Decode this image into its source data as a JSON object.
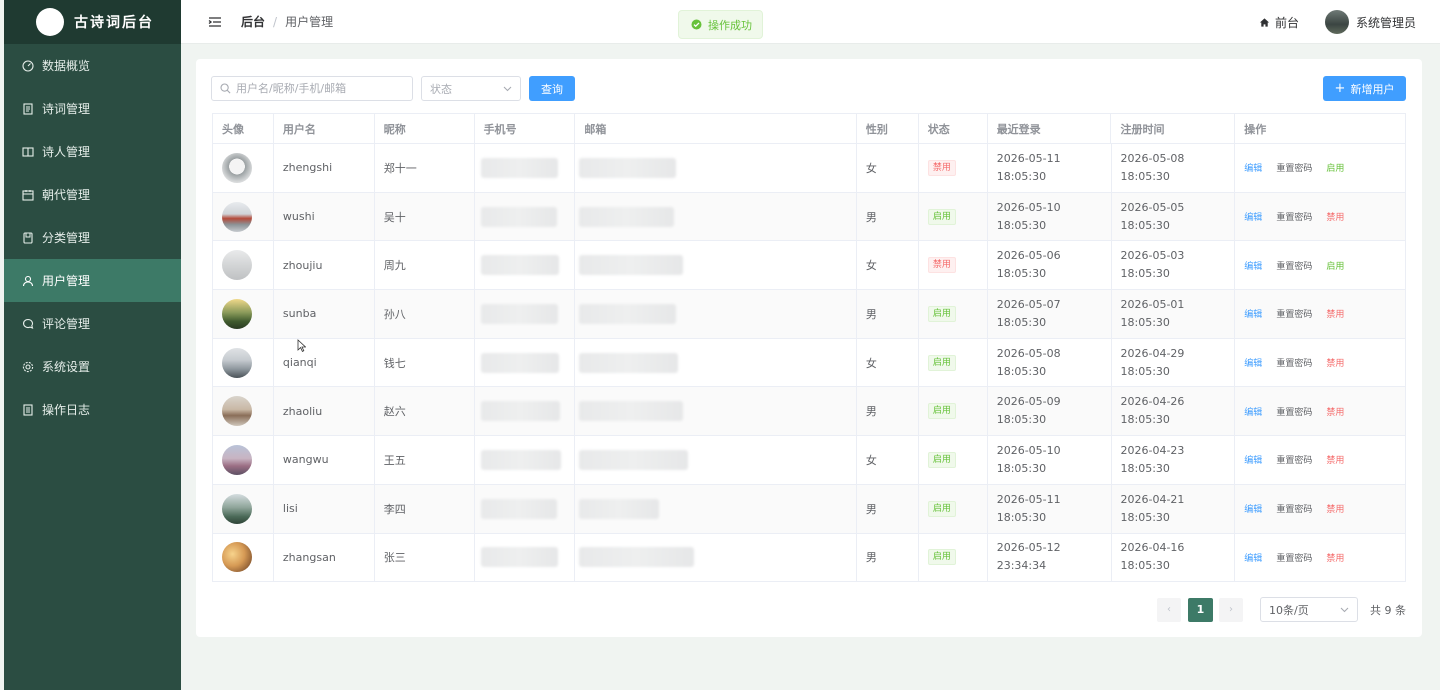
{
  "brand": {
    "title": "古诗词后台"
  },
  "sidebar": {
    "items": [
      {
        "label": "数据概览",
        "icon": "dashboard-icon"
      },
      {
        "label": "诗词管理",
        "icon": "document-icon"
      },
      {
        "label": "诗人管理",
        "icon": "book-icon"
      },
      {
        "label": "朝代管理",
        "icon": "calendar-icon"
      },
      {
        "label": "分类管理",
        "icon": "folder-icon"
      },
      {
        "label": "用户管理",
        "icon": "user-icon",
        "active": true
      },
      {
        "label": "评论管理",
        "icon": "comment-icon"
      },
      {
        "label": "系统设置",
        "icon": "gear-icon"
      },
      {
        "label": "操作日志",
        "icon": "log-icon"
      }
    ]
  },
  "header": {
    "breadcrumb": {
      "home": "后台",
      "separator": "/",
      "current": "用户管理"
    },
    "front_link": "前台",
    "user_name": "系统管理员"
  },
  "toast": {
    "message": "操作成功"
  },
  "toolbar": {
    "search_placeholder": "用户名/昵称/手机/邮箱",
    "status_placeholder": "状态",
    "query_label": "查询",
    "add_label": "新增用户"
  },
  "table": {
    "headers": [
      "头像",
      "用户名",
      "昵称",
      "手机号",
      "邮箱",
      "性别",
      "状态",
      "最近登录",
      "注册时间",
      "操作"
    ],
    "rows": [
      {
        "username": "zhengshi",
        "nickname": "郑十一",
        "gender": "女",
        "status": "禁用",
        "last_date": "2026-05-11",
        "last_time": "18:05:30",
        "reg_date": "2026-05-08",
        "reg_time": "18:05:30",
        "toggle": "启用"
      },
      {
        "username": "wushi",
        "nickname": "吴十",
        "gender": "男",
        "status": "启用",
        "last_date": "2026-05-10",
        "last_time": "18:05:30",
        "reg_date": "2026-05-05",
        "reg_time": "18:05:30",
        "toggle": "禁用"
      },
      {
        "username": "zhoujiu",
        "nickname": "周九",
        "gender": "女",
        "status": "禁用",
        "last_date": "2026-05-06",
        "last_time": "18:05:30",
        "reg_date": "2026-05-03",
        "reg_time": "18:05:30",
        "toggle": "启用"
      },
      {
        "username": "sunba",
        "nickname": "孙八",
        "gender": "男",
        "status": "启用",
        "last_date": "2026-05-07",
        "last_time": "18:05:30",
        "reg_date": "2026-05-01",
        "reg_time": "18:05:30",
        "toggle": "禁用"
      },
      {
        "username": "qianqi",
        "nickname": "钱七",
        "gender": "女",
        "status": "启用",
        "last_date": "2026-05-08",
        "last_time": "18:05:30",
        "reg_date": "2026-04-29",
        "reg_time": "18:05:30",
        "toggle": "禁用"
      },
      {
        "username": "zhaoliu",
        "nickname": "赵六",
        "gender": "男",
        "status": "启用",
        "last_date": "2026-05-09",
        "last_time": "18:05:30",
        "reg_date": "2026-04-26",
        "reg_time": "18:05:30",
        "toggle": "禁用"
      },
      {
        "username": "wangwu",
        "nickname": "王五",
        "gender": "女",
        "status": "启用",
        "last_date": "2026-05-10",
        "last_time": "18:05:30",
        "reg_date": "2026-04-23",
        "reg_time": "18:05:30",
        "toggle": "禁用"
      },
      {
        "username": "lisi",
        "nickname": "李四",
        "gender": "男",
        "status": "启用",
        "last_date": "2026-05-11",
        "last_time": "18:05:30",
        "reg_date": "2026-04-21",
        "reg_time": "18:05:30",
        "toggle": "禁用"
      },
      {
        "username": "zhangsan",
        "nickname": "张三",
        "gender": "男",
        "status": "启用",
        "last_date": "2026-05-12",
        "last_time": "23:34:34",
        "reg_date": "2026-04-16",
        "reg_time": "18:05:30",
        "toggle": "禁用"
      }
    ],
    "edit_label": "编辑",
    "reset_label": "重置密码"
  },
  "pagination": {
    "prev": "‹",
    "next": "›",
    "current_page": "1",
    "page_size": "10条/页",
    "total": "共 9 条"
  },
  "colors": {
    "sidebar_bg": "#2b4d42",
    "sidebar_active": "#3d7a67",
    "primary": "#409eff",
    "success": "#67c23a",
    "danger": "#f56c6c"
  }
}
